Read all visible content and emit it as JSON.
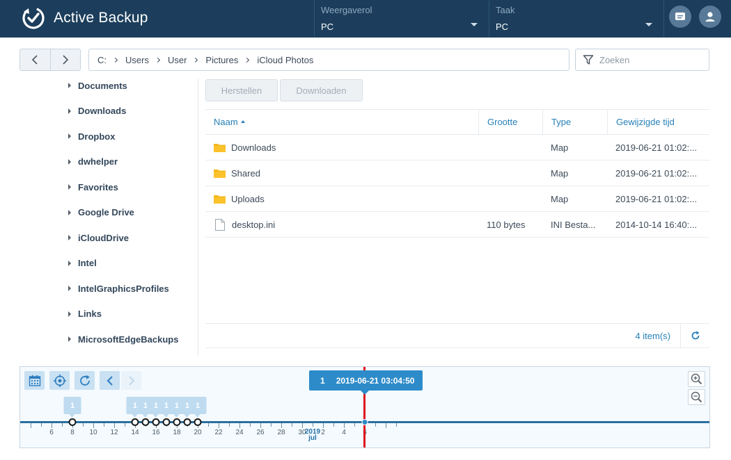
{
  "app": {
    "title": "Active Backup"
  },
  "header": {
    "view_role": {
      "label": "Weergaverol",
      "value": "PC"
    },
    "task": {
      "label": "Taak",
      "value": "PC"
    },
    "icons": [
      "message-icon",
      "user-icon"
    ]
  },
  "breadcrumb": [
    "C:",
    "Users",
    "User",
    "Pictures",
    "iCloud Photos"
  ],
  "search": {
    "placeholder": "Zoeken"
  },
  "tree": [
    "Documents",
    "Downloads",
    "Dropbox",
    "dwhelper",
    "Favorites",
    "Google Drive",
    "iCloudDrive",
    "Intel",
    "IntelGraphicsProfiles",
    "Links",
    "MicrosoftEdgeBackups"
  ],
  "toolbar": {
    "restore_label": "Herstellen",
    "download_label": "Downloaden"
  },
  "table": {
    "columns": [
      "Naam",
      "Grootte",
      "Type",
      "Gewijzigde tijd"
    ],
    "sorted_column": "Naam",
    "rows": [
      {
        "icon": "folder-icon",
        "name": "Downloads",
        "size": "",
        "type": "Map",
        "modified": "2019-06-21 01:02:..."
      },
      {
        "icon": "folder-icon",
        "name": "Shared",
        "size": "",
        "type": "Map",
        "modified": "2019-06-21 01:02:..."
      },
      {
        "icon": "folder-icon",
        "name": "Uploads",
        "size": "",
        "type": "Map",
        "modified": "2019-06-21 01:02:..."
      },
      {
        "icon": "file-icon",
        "name": "desktop.ini",
        "size": "110 bytes",
        "type": "INI Besta...",
        "modified": "2014-10-14 16:40:..."
      }
    ],
    "item_count": "4 item(s)"
  },
  "timeline": {
    "selected": {
      "count": "1",
      "timestamp": "2019-06-21 03:04:50"
    },
    "tick_labels": [
      "6",
      "8",
      "10",
      "12",
      "14",
      "16",
      "18",
      "20",
      "22",
      "24",
      "26",
      "28",
      "30",
      "2019 jul",
      "2",
      "4",
      "6"
    ],
    "month_label": {
      "year": "2019",
      "month": "jul"
    },
    "versions": [
      {
        "day": 8,
        "count": "1"
      },
      {
        "day": 14,
        "count": "1"
      },
      {
        "day": 15,
        "count": "1"
      },
      {
        "day": 16,
        "count": "1"
      },
      {
        "day": 17,
        "count": "1"
      },
      {
        "day": 18,
        "count": "1"
      },
      {
        "day": 19,
        "count": "1"
      },
      {
        "day": 20,
        "count": "1"
      }
    ],
    "current_day": 21,
    "colors": {
      "accent": "#2e8bc9",
      "marker": "#e0131e",
      "header": "#1c3e5c"
    }
  }
}
